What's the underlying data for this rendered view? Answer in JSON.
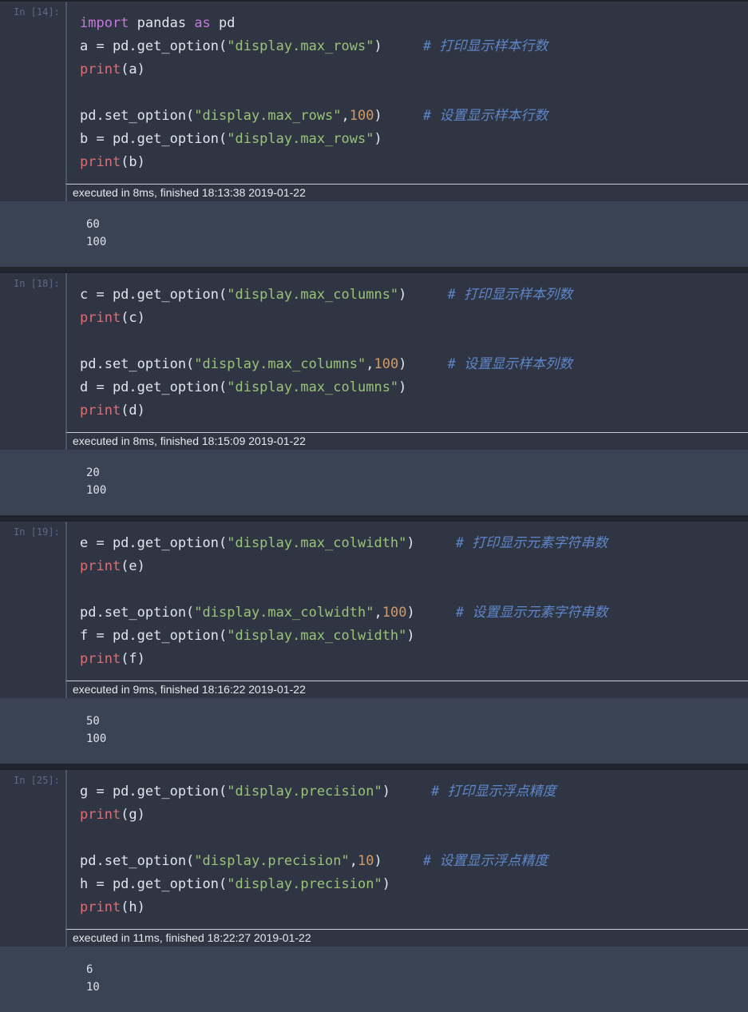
{
  "cells": [
    {
      "prompt": "In [14]:",
      "lines": [
        [
          {
            "t": "import",
            "c": "kw"
          },
          {
            "t": " pandas ",
            "c": ""
          },
          {
            "t": "as",
            "c": "kw"
          },
          {
            "t": " pd",
            "c": ""
          }
        ],
        [
          {
            "t": "a = pd.get_option(",
            "c": ""
          },
          {
            "t": "\"display.max_rows\"",
            "c": "str"
          },
          {
            "t": ")     ",
            "c": ""
          },
          {
            "t": "# 打印显示样本行数",
            "c": "cmt"
          }
        ],
        [
          {
            "t": "print",
            "c": "fn"
          },
          {
            "t": "(a)",
            "c": ""
          }
        ],
        [],
        [
          {
            "t": "pd.set_option(",
            "c": ""
          },
          {
            "t": "\"display.max_rows\"",
            "c": "str"
          },
          {
            "t": ",",
            "c": ""
          },
          {
            "t": "100",
            "c": "num"
          },
          {
            "t": ")     ",
            "c": ""
          },
          {
            "t": "# 设置显示样本行数",
            "c": "cmt"
          }
        ],
        [
          {
            "t": "b = pd.get_option(",
            "c": ""
          },
          {
            "t": "\"display.max_rows\"",
            "c": "str"
          },
          {
            "t": ")",
            "c": ""
          }
        ],
        [
          {
            "t": "print",
            "c": "fn"
          },
          {
            "t": "(b)",
            "c": ""
          }
        ]
      ],
      "exec": "executed in 8ms, finished 18:13:38 2019-01-22",
      "output": "60\n100"
    },
    {
      "prompt": "In [18]:",
      "lines": [
        [
          {
            "t": "c = pd.get_option(",
            "c": ""
          },
          {
            "t": "\"display.max_columns\"",
            "c": "str"
          },
          {
            "t": ")     ",
            "c": ""
          },
          {
            "t": "# 打印显示样本列数",
            "c": "cmt"
          }
        ],
        [
          {
            "t": "print",
            "c": "fn"
          },
          {
            "t": "(c)",
            "c": ""
          }
        ],
        [],
        [
          {
            "t": "pd.set_option(",
            "c": ""
          },
          {
            "t": "\"display.max_columns\"",
            "c": "str"
          },
          {
            "t": ",",
            "c": ""
          },
          {
            "t": "100",
            "c": "num"
          },
          {
            "t": ")     ",
            "c": ""
          },
          {
            "t": "# 设置显示样本列数",
            "c": "cmt"
          }
        ],
        [
          {
            "t": "d = pd.get_option(",
            "c": ""
          },
          {
            "t": "\"display.max_columns\"",
            "c": "str"
          },
          {
            "t": ")",
            "c": ""
          }
        ],
        [
          {
            "t": "print",
            "c": "fn"
          },
          {
            "t": "(d)",
            "c": ""
          }
        ]
      ],
      "exec": "executed in 8ms, finished 18:15:09 2019-01-22",
      "output": "20\n100"
    },
    {
      "prompt": "In [19]:",
      "lines": [
        [
          {
            "t": "e = pd.get_option(",
            "c": ""
          },
          {
            "t": "\"display.max_colwidth\"",
            "c": "str"
          },
          {
            "t": ")     ",
            "c": ""
          },
          {
            "t": "# 打印显示元素字符串数",
            "c": "cmt"
          }
        ],
        [
          {
            "t": "print",
            "c": "fn"
          },
          {
            "t": "(e)",
            "c": ""
          }
        ],
        [],
        [
          {
            "t": "pd.set_option(",
            "c": ""
          },
          {
            "t": "\"display.max_colwidth\"",
            "c": "str"
          },
          {
            "t": ",",
            "c": ""
          },
          {
            "t": "100",
            "c": "num"
          },
          {
            "t": ")     ",
            "c": ""
          },
          {
            "t": "# 设置显示元素字符串数",
            "c": "cmt"
          }
        ],
        [
          {
            "t": "f = pd.get_option(",
            "c": ""
          },
          {
            "t": "\"display.max_colwidth\"",
            "c": "str"
          },
          {
            "t": ")",
            "c": ""
          }
        ],
        [
          {
            "t": "print",
            "c": "fn"
          },
          {
            "t": "(f)",
            "c": ""
          }
        ]
      ],
      "exec": "executed in 9ms, finished 18:16:22 2019-01-22",
      "output": "50\n100"
    },
    {
      "prompt": "In [25]:",
      "lines": [
        [
          {
            "t": "g = pd.get_option(",
            "c": ""
          },
          {
            "t": "\"display.precision\"",
            "c": "str"
          },
          {
            "t": ")     ",
            "c": ""
          },
          {
            "t": "# 打印显示浮点精度",
            "c": "cmt"
          }
        ],
        [
          {
            "t": "print",
            "c": "fn"
          },
          {
            "t": "(g)",
            "c": ""
          }
        ],
        [],
        [
          {
            "t": "pd.set_option(",
            "c": ""
          },
          {
            "t": "\"display.precision\"",
            "c": "str"
          },
          {
            "t": ",",
            "c": ""
          },
          {
            "t": "10",
            "c": "num"
          },
          {
            "t": ")     ",
            "c": ""
          },
          {
            "t": "# 设置显示浮点精度",
            "c": "cmt"
          }
        ],
        [
          {
            "t": "h = pd.get_option(",
            "c": ""
          },
          {
            "t": "\"display.precision\"",
            "c": "str"
          },
          {
            "t": ")",
            "c": ""
          }
        ],
        [
          {
            "t": "print",
            "c": "fn"
          },
          {
            "t": "(h)",
            "c": ""
          }
        ]
      ],
      "exec": "executed in 11ms, finished 18:22:27 2019-01-22",
      "output": "6\n10"
    }
  ]
}
